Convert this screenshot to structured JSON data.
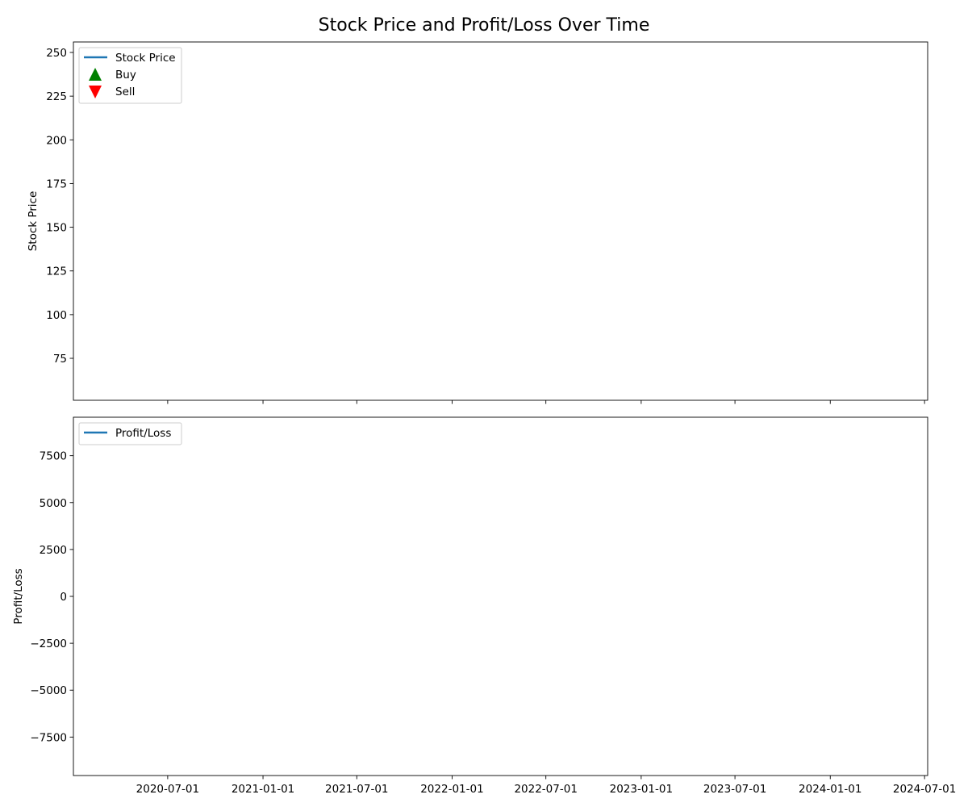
{
  "chart_data": {
    "type": "line",
    "title": "Stock Price and Profit/Loss Over Time",
    "shared_x": {
      "ticks": [
        "2020-07-01",
        "2021-01-01",
        "2021-07-01",
        "2022-01-01",
        "2022-07-01",
        "2023-01-01",
        "2023-07-01",
        "2024-01-01",
        "2024-07-01"
      ],
      "xlim": [
        "2020-01-01",
        "2024-07-07"
      ]
    },
    "panels": [
      {
        "ylabel": "Stock Price",
        "ylim": [
          51,
          256
        ],
        "yticks": [
          75,
          100,
          125,
          150,
          175,
          200,
          225,
          250
        ],
        "show_x_tick_labels": false,
        "legend": {
          "placement": "top-left",
          "entries": [
            {
              "label": "Stock Price",
              "marker": "line",
              "color": "#1f77b4"
            },
            {
              "label": "Buy",
              "marker": "triangle-up",
              "color": "#008000"
            },
            {
              "label": "Sell",
              "marker": "triangle-down",
              "color": "#ff0000"
            }
          ]
        },
        "series": []
      },
      {
        "ylabel": "Profit/Loss",
        "ylim": [
          -9550,
          9550
        ],
        "yticks": [
          7500,
          5000,
          2500,
          0,
          -2500,
          -5000,
          -7500
        ],
        "ytick_labels": [
          "7500",
          "5000",
          "2500",
          "0",
          "−2500",
          "−5000",
          "−7500"
        ],
        "show_x_tick_labels": true,
        "legend": {
          "placement": "top-left",
          "entries": [
            {
              "label": "Profit/Loss",
              "marker": "line",
              "color": "#1f77b4"
            }
          ]
        },
        "series": []
      }
    ]
  }
}
